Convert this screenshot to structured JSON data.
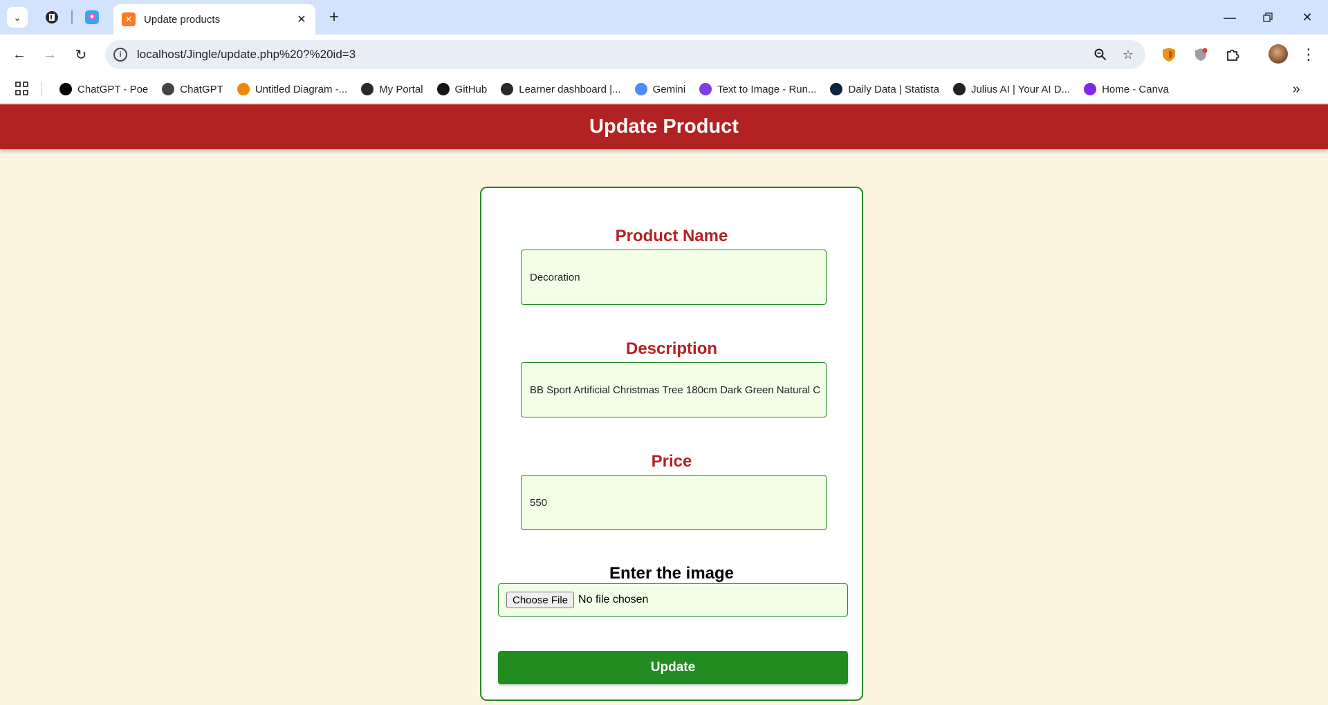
{
  "browser": {
    "tab": {
      "title": "Update products",
      "favicon": "xampp-favicon"
    },
    "url": "localhost/Jingle/update.php%20?%20id=3",
    "bookmarks": [
      {
        "label": "ChatGPT - Poe",
        "icon": "poe-icon",
        "color": "#000000"
      },
      {
        "label": "ChatGPT",
        "icon": "openai-icon",
        "color": "#444444"
      },
      {
        "label": "Untitled Diagram -...",
        "icon": "drawio-icon",
        "color": "#f08705"
      },
      {
        "label": "My Portal",
        "icon": "alx-icon",
        "color": "#2a2a2a"
      },
      {
        "label": "GitHub",
        "icon": "github-icon",
        "color": "#181717"
      },
      {
        "label": "Learner dashboard |...",
        "icon": "alx-icon",
        "color": "#2a2a2a"
      },
      {
        "label": "Gemini",
        "icon": "gemini-icon",
        "color": "#4f8cf7"
      },
      {
        "label": "Text to Image - Run...",
        "icon": "runway-icon",
        "color": "#7b3fe4"
      },
      {
        "label": "Daily Data | Statista",
        "icon": "statista-icon",
        "color": "#0a2540"
      },
      {
        "label": "Julius AI | Your AI D...",
        "icon": "julius-icon",
        "color": "#222222"
      },
      {
        "label": "Home - Canva",
        "icon": "canva-icon",
        "color": "#7d2ae8"
      }
    ]
  },
  "page": {
    "header": "Update Product",
    "fields": {
      "name": {
        "label": "Product Name",
        "value": "Decoration"
      },
      "description": {
        "label": "Description",
        "value": "BB Sport Artificial Christmas Tree 180cm Dark Green Natural C"
      },
      "price": {
        "label": "Price",
        "value": "550"
      }
    },
    "image": {
      "label": "Enter the image",
      "button": "Choose File",
      "status": "No file chosen"
    },
    "submit": "Update"
  },
  "colors": {
    "header": "#b22222",
    "accent": "#228b22",
    "background": "#fdf5e1",
    "input_bg": "#f2ffe6"
  }
}
